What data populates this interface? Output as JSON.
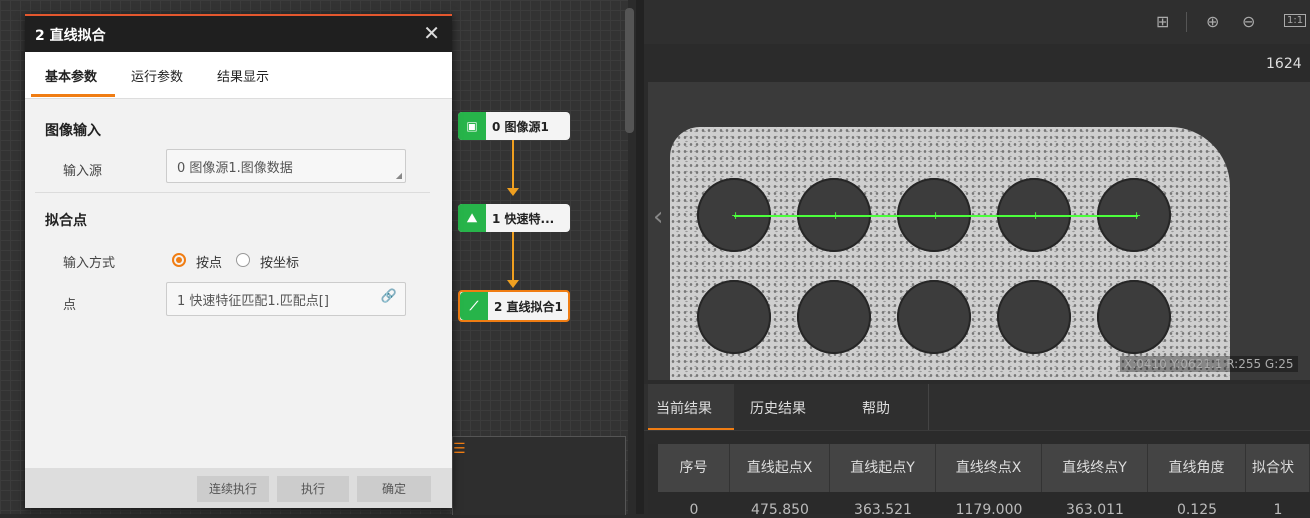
{
  "dialog": {
    "title": "2 直线拟合",
    "close": "✕",
    "tabs": [
      "基本参数",
      "运行参数",
      "结果显示"
    ],
    "image_input": {
      "section": "图像输入",
      "label": "输入源",
      "value": "0 图像源1.图像数据"
    },
    "fit_points": {
      "section": "拟合点",
      "mode_label": "输入方式",
      "options": [
        "按点",
        "按坐标"
      ],
      "selected": "按点",
      "point_label": "点",
      "point_value": "1 快速特征匹配1.匹配点[]"
    },
    "footer": {
      "continuous": "连续执行",
      "run": "执行",
      "ok": "确定"
    }
  },
  "flow": {
    "nodes": [
      {
        "label": "0 图像源1",
        "icon": "image-icon"
      },
      {
        "label": "1 快速特...",
        "icon": "feature-match-icon"
      },
      {
        "label": "2 直线拟合1",
        "icon": "line-fit-icon"
      }
    ]
  },
  "toolbar": {
    "icons": [
      "grid-icon",
      "zoom-in-icon",
      "zoom-out-icon",
      "actual-size-icon"
    ],
    "actual_size": "1:1"
  },
  "image": {
    "top_right_value": "1624",
    "pixel_info": "X:0410 Y:0621.1 R:255 G:25"
  },
  "results": {
    "tabs": [
      "当前结果",
      "历史结果",
      "帮助"
    ],
    "columns": [
      "序号",
      "直线起点X",
      "直线起点Y",
      "直线终点X",
      "直线终点Y",
      "直线角度",
      "拟合状"
    ],
    "row": [
      "0",
      "475.850",
      "363.521",
      "1179.000",
      "363.011",
      "0.125",
      "1"
    ]
  },
  "colors": {
    "accent": "#f07d13",
    "node_green": "#27b44a",
    "fit_line": "#4cff3c"
  }
}
